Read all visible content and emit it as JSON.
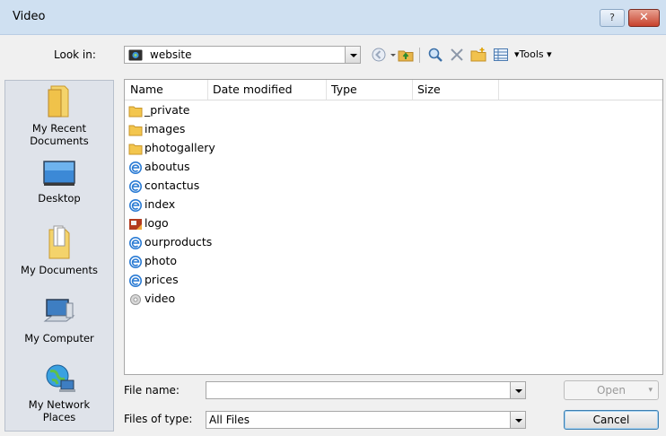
{
  "window": {
    "title": "Video"
  },
  "toolbar": {
    "lookin_label": "Look in:",
    "lookin_value": "website",
    "tools_label": "Tools"
  },
  "places": [
    {
      "label": "My Recent\nDocuments",
      "icon": "recent-documents-icon"
    },
    {
      "label": "Desktop",
      "icon": "desktop-icon"
    },
    {
      "label": "My Documents",
      "icon": "my-documents-icon"
    },
    {
      "label": "My Computer",
      "icon": "my-computer-icon"
    },
    {
      "label": "My Network\nPlaces",
      "icon": "network-places-icon"
    }
  ],
  "columns": [
    "Name",
    "Date modified",
    "Type",
    "Size"
  ],
  "files": [
    {
      "name": "_private",
      "icon": "folder-icon"
    },
    {
      "name": "images",
      "icon": "folder-icon"
    },
    {
      "name": "photogallery",
      "icon": "folder-icon"
    },
    {
      "name": "aboutus",
      "icon": "html-page-icon"
    },
    {
      "name": "contactus",
      "icon": "html-page-icon"
    },
    {
      "name": "index",
      "icon": "html-page-icon"
    },
    {
      "name": "logo",
      "icon": "image-file-icon"
    },
    {
      "name": "ourproducts",
      "icon": "html-page-icon"
    },
    {
      "name": "photo",
      "icon": "html-page-icon"
    },
    {
      "name": "prices",
      "icon": "html-page-icon"
    },
    {
      "name": "video",
      "icon": "video-file-icon"
    }
  ],
  "footer": {
    "filename_label": "File name:",
    "filename_value": "",
    "filetype_label": "Files of type:",
    "filetype_value": "All Files",
    "open_label": "Open",
    "cancel_label": "Cancel"
  },
  "colors": {
    "titlebar": "#cfe0f1",
    "close": "#c7422d",
    "panel": "#dfe3ea"
  }
}
